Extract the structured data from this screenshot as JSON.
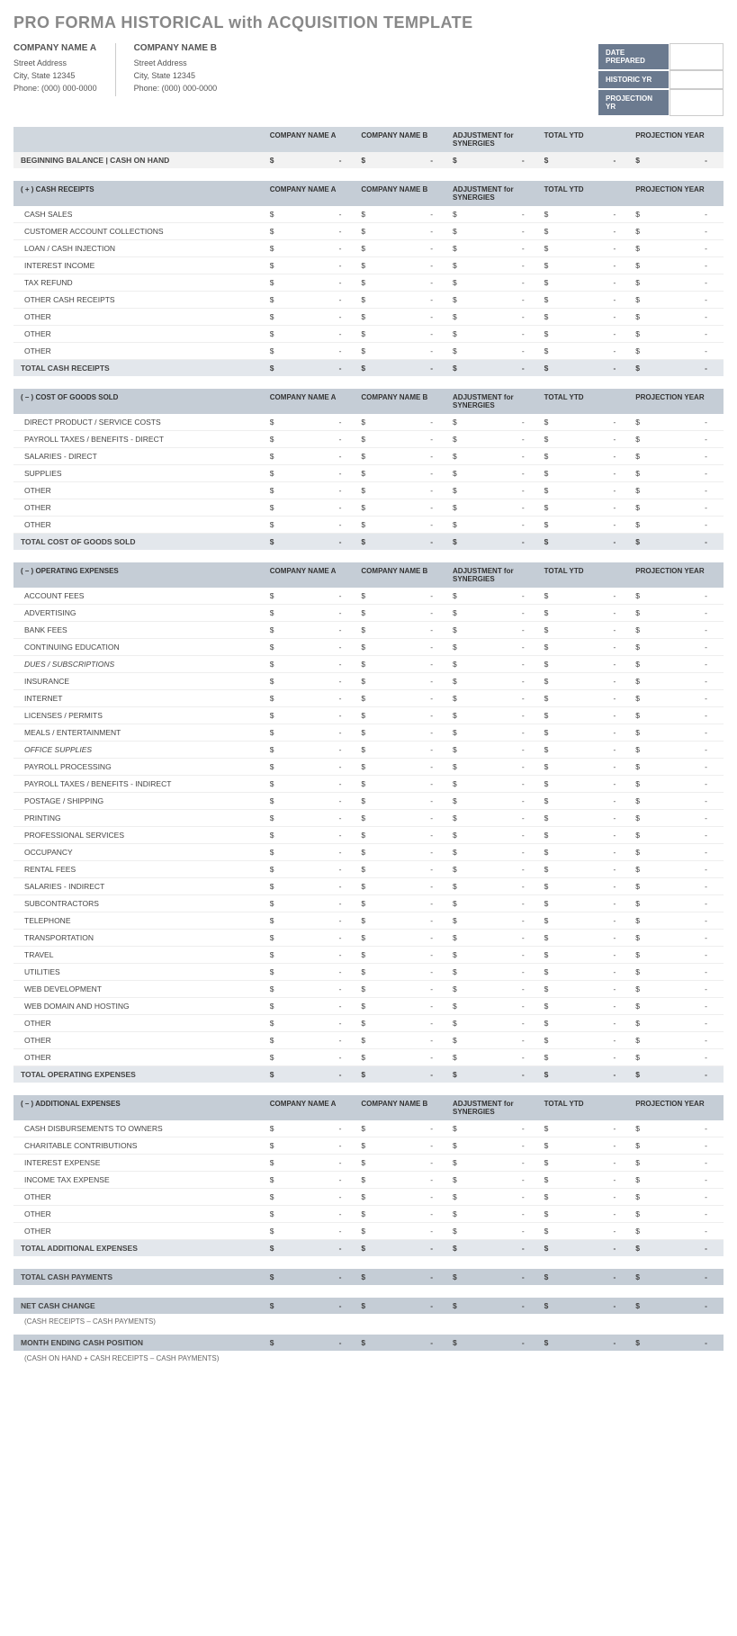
{
  "title": "PRO FORMA HISTORICAL with ACQUISITION TEMPLATE",
  "companyA": {
    "name": "COMPANY NAME A",
    "addr": "Street Address",
    "city": "City, State  12345",
    "phone": "Phone: (000) 000-0000"
  },
  "companyB": {
    "name": "COMPANY NAME B",
    "addr": "Street Address",
    "city": "City, State  12345",
    "phone": "Phone: (000) 000-0000"
  },
  "dates": {
    "prepared": "DATE PREPARED",
    "historic": "HISTORIC YR",
    "projection": "PROJECTION YR"
  },
  "cols": {
    "a": "COMPANY NAME A",
    "b": "COMPANY NAME B",
    "adj": "ADJUSTMENT for SYNERGIES",
    "ytd": "TOTAL YTD",
    "proj": "PROJECTION YEAR"
  },
  "begin": "BEGINNING BALANCE  |  CASH ON HAND",
  "dollar": "$",
  "dash": "-",
  "sections": [
    {
      "title": "( + )  CASH RECEIPTS",
      "rows": [
        "CASH SALES",
        "CUSTOMER ACCOUNT COLLECTIONS",
        "LOAN / CASH INJECTION",
        "INTEREST INCOME",
        "TAX REFUND",
        "OTHER CASH RECEIPTS",
        "OTHER",
        "OTHER",
        "OTHER"
      ],
      "total": "TOTAL CASH RECEIPTS"
    },
    {
      "title": "( – )  COST OF GOODS SOLD",
      "rows": [
        "DIRECT PRODUCT / SERVICE COSTS",
        "PAYROLL TAXES / BENEFITS - DIRECT",
        "SALARIES - DIRECT",
        "SUPPLIES",
        "OTHER",
        "OTHER",
        "OTHER"
      ],
      "total": "TOTAL COST OF GOODS SOLD"
    },
    {
      "title": "( – )  OPERATING EXPENSES",
      "rows": [
        "ACCOUNT FEES",
        "ADVERTISING",
        "BANK FEES",
        "CONTINUING EDUCATION",
        "DUES / SUBSCRIPTIONS",
        "INSURANCE",
        "INTERNET",
        "LICENSES / PERMITS",
        "MEALS / ENTERTAINMENT",
        "OFFICE SUPPLIES",
        "PAYROLL PROCESSING",
        "PAYROLL TAXES / BENEFITS - INDIRECT",
        "POSTAGE / SHIPPING",
        "PRINTING",
        "PROFESSIONAL SERVICES",
        "OCCUPANCY",
        "RENTAL FEES",
        "SALARIES - INDIRECT",
        "SUBCONTRACTORS",
        "TELEPHONE",
        "TRANSPORTATION",
        "TRAVEL",
        "UTILITIES",
        "WEB DEVELOPMENT",
        "WEB DOMAIN AND HOSTING",
        "OTHER",
        "OTHER",
        "OTHER"
      ],
      "total": "TOTAL OPERATING EXPENSES",
      "italics": [
        "DUES / SUBSCRIPTIONS",
        "OFFICE SUPPLIES"
      ]
    },
    {
      "title": "( – )  ADDITIONAL EXPENSES",
      "rows": [
        "CASH DISBURSEMENTS TO OWNERS",
        "CHARITABLE CONTRIBUTIONS",
        "INTEREST EXPENSE",
        "INCOME TAX EXPENSE",
        "OTHER",
        "OTHER",
        "OTHER"
      ],
      "total": "TOTAL ADDITIONAL EXPENSES"
    }
  ],
  "summary": {
    "cashPayments": "TOTAL CASH PAYMENTS",
    "netChange": "NET CASH CHANGE",
    "netNote": "(CASH RECEIPTS – CASH PAYMENTS)",
    "ending": "MONTH ENDING CASH POSITION",
    "endNote": "(CASH ON HAND + CASH RECEIPTS – CASH PAYMENTS)"
  }
}
